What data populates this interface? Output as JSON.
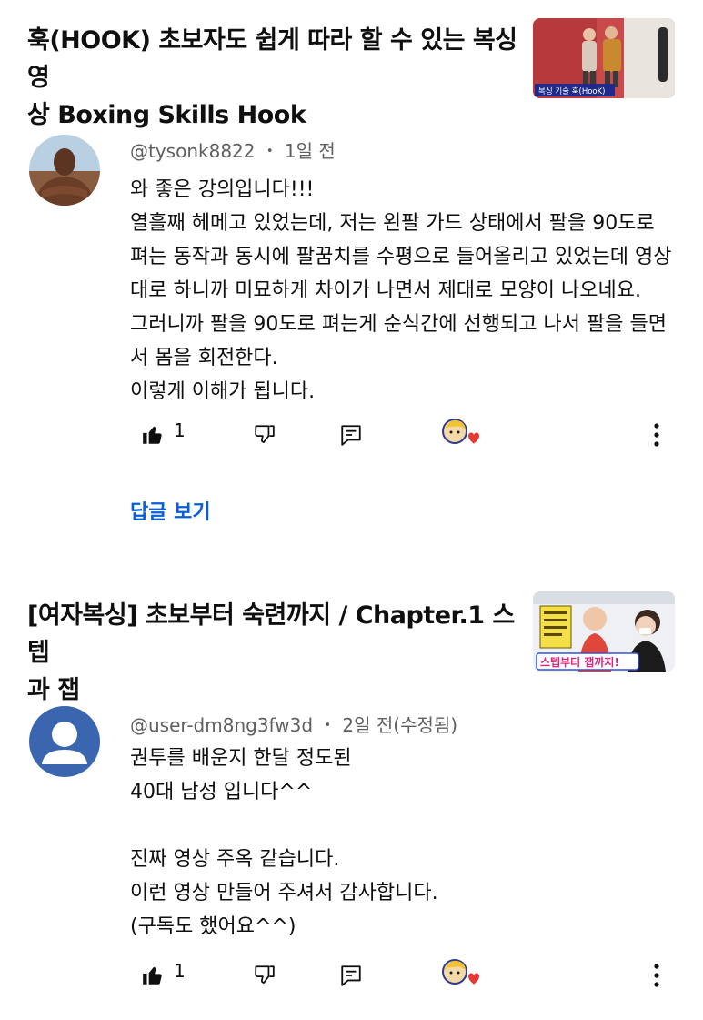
{
  "sections": [
    {
      "video_title_lines": [
        "훅(HOOK) 초보자도 쉽게 따라 할 수 있는 복싱 영",
        "상 Boxing Skills Hook"
      ],
      "thumbnail_caption": "복싱 기술 훅(HooK)",
      "comment": {
        "handle": "@tysonk8822",
        "separator": "•",
        "time": "1일 전",
        "lines": [
          "와 좋은 강의입니다!!!",
          "열흘째 헤메고 있었는데, 저는 왼팔 가드 상태에서 팔을 90도로",
          "펴는 동작과 동시에 팔꿈치를 수평으로 들어올리고 있었는데 영상",
          "대로 하니까 미묘하게 차이가 나면서 제대로 모양이 나오네요.",
          "그러니까 팔을 90도로 펴는게 순식간에 선행되고 나서 팔을 들면",
          "서 몸을 회전한다.",
          "이렇게 이해가 됩니다."
        ],
        "like_count": "1",
        "replies_label": "답글 보기"
      }
    },
    {
      "video_title_lines": [
        "[여자복싱] 초보부터 숙련까지 / Chapter.1 스텝",
        "과 잽"
      ],
      "thumbnail_caption": "스텝부터 잽까지!",
      "comment": {
        "handle": "@user-dm8ng3fw3d",
        "separator": "•",
        "time": "2일 전(수정됨)",
        "lines": [
          "권투를 배운지 한달 정도된",
          "40대 남성 입니다^^",
          "",
          "진짜 영상 주옥 같습니다.",
          "이런 영상 만들어 주셔서 감사합니다.",
          "(구독도 했어요^^)"
        ],
        "like_count": "1"
      }
    }
  ],
  "colors": {
    "link_blue": "#065fd4",
    "meta_gray": "#606060",
    "text": "#0f0f0f",
    "heart_red": "#e53935",
    "default_avatar_blue": "#3a66b0"
  },
  "icons": {
    "like": "thumbs-up-filled-icon",
    "dislike": "thumbs-down-outline-icon",
    "reply": "reply-comment-icon",
    "creator_heart": "creator-heart-icon",
    "more": "more-vertical-icon"
  }
}
